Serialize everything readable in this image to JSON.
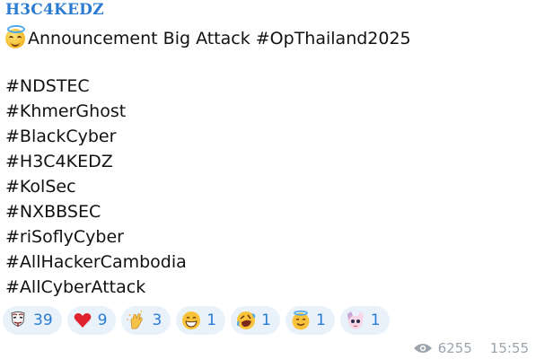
{
  "message": {
    "sender": "H3C4KEDZ",
    "announcement": "Announcement Big Attack #OpThailand2025",
    "hashtags": [
      "#NDSTEC",
      "#KhmerGhost",
      "#BlackCyber",
      "#H3C4KEDZ",
      "#KolSec",
      "#NXBBSEC",
      "#riSoflyCyber",
      "#AllHackerCambodia",
      "#AllCyberAttack"
    ],
    "reactions": [
      {
        "icon": "anonymous-mask-icon",
        "count": "39"
      },
      {
        "icon": "red-heart-icon",
        "count": "9"
      },
      {
        "icon": "clapping-hands-icon",
        "count": "3"
      },
      {
        "icon": "grinning-face-icon",
        "count": "1"
      },
      {
        "icon": "rofl-face-icon",
        "count": "1"
      },
      {
        "icon": "halo-face-icon",
        "count": "1"
      },
      {
        "icon": "anime-sticker-icon",
        "count": "1"
      }
    ],
    "views": "6255",
    "time": "15:55"
  },
  "colors": {
    "sender": "#2a7bd1",
    "reaction_bg": "#e9f2fb",
    "reaction_count": "#2a7bd1",
    "meta": "#9aa4ad"
  }
}
